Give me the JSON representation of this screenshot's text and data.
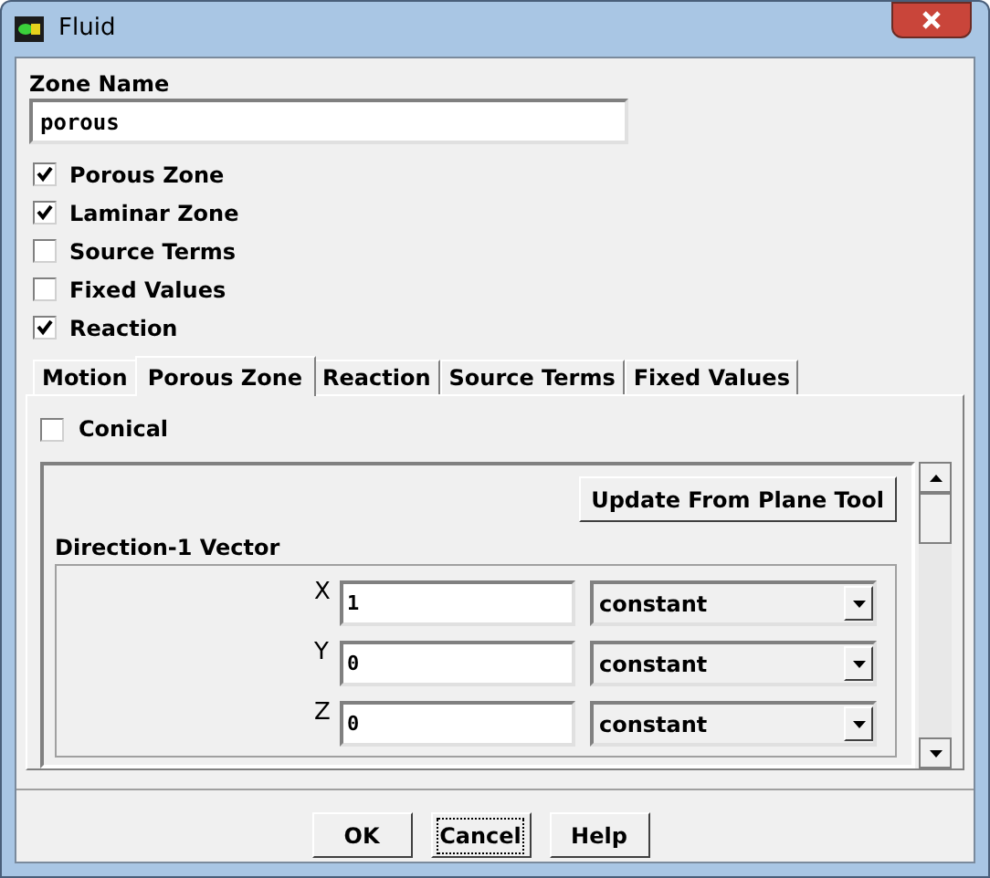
{
  "window": {
    "title": "Fluid"
  },
  "zone_name": {
    "label": "Zone Name",
    "value": "porous"
  },
  "options": [
    {
      "label": "Porous Zone",
      "checked": true
    },
    {
      "label": "Laminar Zone",
      "checked": true
    },
    {
      "label": "Source Terms",
      "checked": false
    },
    {
      "label": "Fixed Values",
      "checked": false
    },
    {
      "label": "Reaction",
      "checked": true
    }
  ],
  "tabs": [
    {
      "label": "Motion",
      "selected": false
    },
    {
      "label": "Porous Zone",
      "selected": true
    },
    {
      "label": "Reaction",
      "selected": false
    },
    {
      "label": "Source Terms",
      "selected": false
    },
    {
      "label": "Fixed Values",
      "selected": false
    }
  ],
  "conical": {
    "label": "Conical",
    "checked": false
  },
  "update_button": "Update From Plane Tool",
  "direction_vector": {
    "title": "Direction-1 Vector",
    "rows": [
      {
        "axis": "X",
        "value": "1",
        "method": "constant"
      },
      {
        "axis": "Y",
        "value": "0",
        "method": "constant"
      },
      {
        "axis": "Z",
        "value": "0",
        "method": "constant"
      }
    ]
  },
  "buttons": [
    {
      "label": "OK",
      "focused": false
    },
    {
      "label": "Cancel",
      "focused": true
    },
    {
      "label": "Help",
      "focused": false
    }
  ]
}
